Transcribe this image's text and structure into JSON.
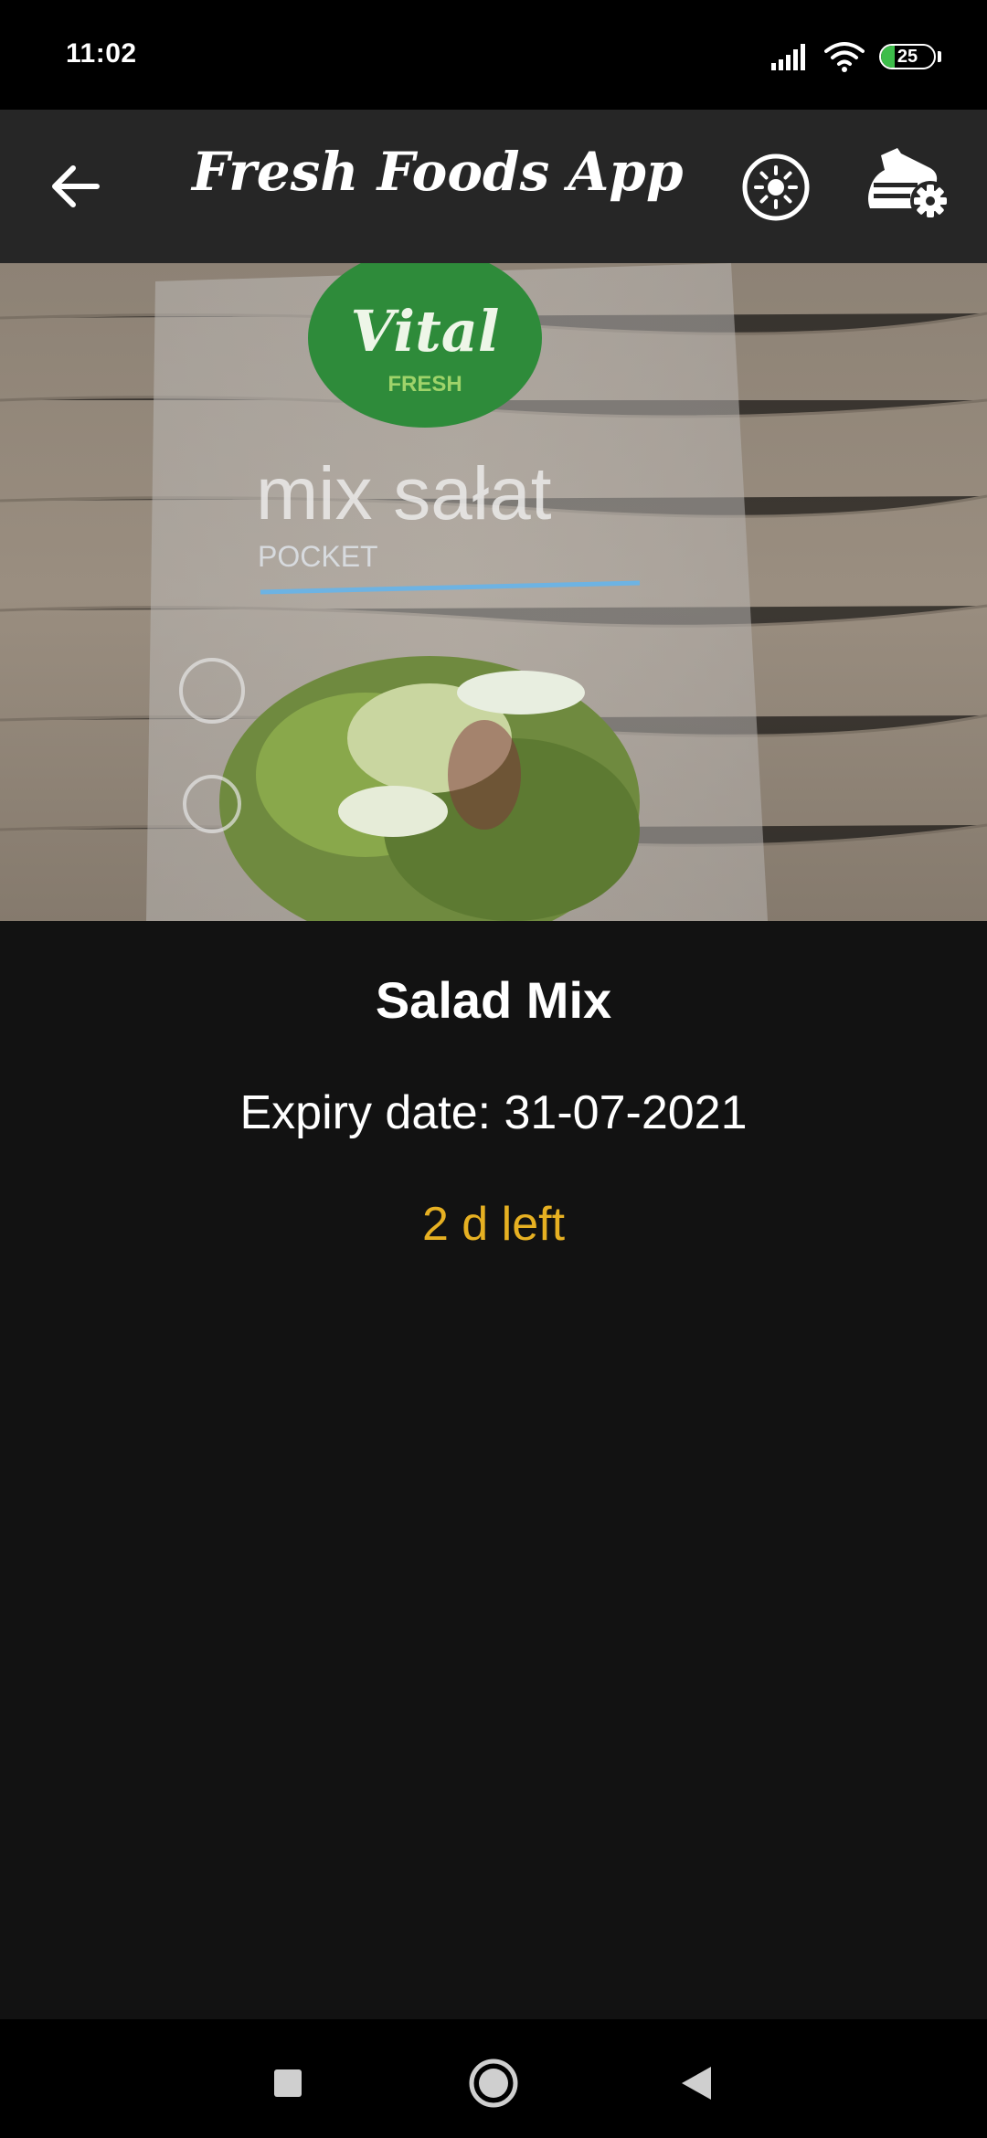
{
  "status_bar": {
    "time": "11:02",
    "battery_level": "25",
    "battery_fraction": 0.25,
    "icons": [
      "signal-icon",
      "wifi-icon",
      "battery-icon"
    ]
  },
  "app_bar": {
    "title": "Fresh Foods App",
    "icons": [
      "back-arrow-icon",
      "brightness-icon",
      "settings-icon"
    ]
  },
  "product": {
    "name": "Salad Mix",
    "expiry_label": "Expiry date: 31-07-2021",
    "days_left": "2 d left",
    "image_lettering": [
      "Vital",
      "FRESH",
      "mix sałat",
      "POCKET"
    ]
  },
  "colors": {
    "background": "#121212",
    "app_bar": "#262626",
    "days_left": "#e6b022",
    "battery": "#3dbd4a"
  },
  "nav_bar": {
    "icons": [
      "recents-icon",
      "home-icon",
      "back-icon"
    ]
  }
}
